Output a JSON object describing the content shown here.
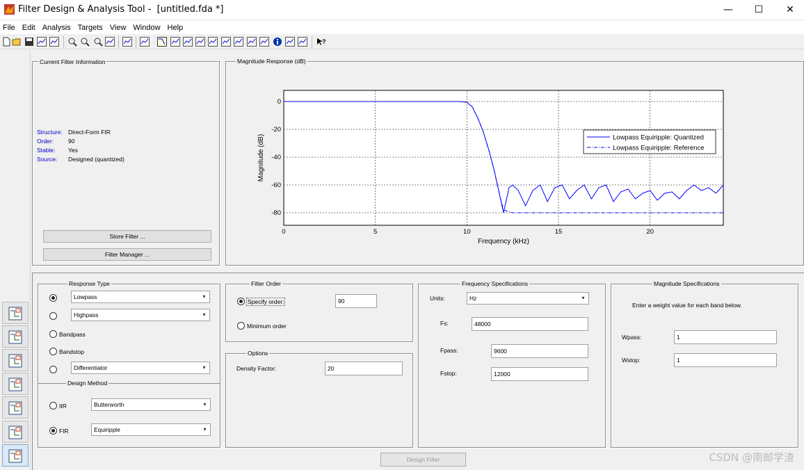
{
  "window": {
    "title": "Filter Design & Analysis Tool -  [untitled.fda *]",
    "minimize_glyph": "—",
    "maximize_glyph": "☐",
    "close_glyph": "✕"
  },
  "menu": [
    "File",
    "Edit",
    "Analysis",
    "Targets",
    "View",
    "Window",
    "Help"
  ],
  "toolbar_icons": [
    "new-icon",
    "open-icon",
    "save-icon",
    "print-icon",
    "print-preview-icon",
    "zoom-in-icon",
    "zoom-x-icon",
    "zoom-y-icon",
    "full-view-icon",
    "new-figure-icon",
    "full-view-analysis-icon",
    "magnitude-response-icon",
    "phase-response-icon",
    "magnitude-phase-icon",
    "group-delay-icon",
    "phase-delay-icon",
    "impulse-response-icon",
    "step-response-icon",
    "pole-zero-icon",
    "coefficients-icon",
    "info-icon",
    "quantization-icon",
    "noise-loading-icon",
    "whats-this-icon"
  ],
  "sidebar_icons": [
    "transform-filter-icon",
    "create-multirate-icon",
    "quantize-icon",
    "realize-model-icon",
    "import-filter-icon",
    "pole-zero-editor-icon",
    "design-filter-icon"
  ],
  "current_filter": {
    "title": "Current Filter Information",
    "rows": [
      {
        "key": "Structure:",
        "value": "Direct-Form FIR"
      },
      {
        "key": "Order:",
        "value": "90"
      },
      {
        "key": "Stable:",
        "value": "Yes"
      },
      {
        "key": "Source:",
        "value": "Designed (quantized)"
      }
    ],
    "store_button": "Store Filter ...",
    "manager_button": "Filter Manager ..."
  },
  "plot": {
    "title": "Magnitude Response (dB)"
  },
  "chart_data": {
    "type": "line",
    "xlabel": "Frequency (kHz)",
    "ylabel": "Magnitude (dB)",
    "xlim": [
      0,
      24
    ],
    "ylim": [
      -70,
      8
    ],
    "xticks": [
      "0",
      "5",
      "10",
      "15",
      "20"
    ],
    "yticks": [
      "0",
      "-20",
      "-40",
      "-60",
      "-80"
    ],
    "grid": true,
    "legend_position": "right",
    "series": [
      {
        "name": "Lowpass Equiripple: Quantized",
        "style": "solid",
        "color": "#0000ff",
        "x": [
          0,
          9.6,
          10,
          10.3,
          10.6,
          10.9,
          11.2,
          11.5,
          11.8,
          12,
          12.3,
          12.5,
          12.8,
          13.2,
          13.6,
          14,
          14.4,
          14.8,
          15.2,
          15.6,
          16,
          16.4,
          16.8,
          17.2,
          17.6,
          18,
          18.4,
          18.8,
          19.2,
          19.6,
          20,
          20.4,
          20.8,
          21.2,
          21.6,
          22,
          22.4,
          22.8,
          23.2,
          23.6,
          24
        ],
        "y": [
          0,
          0,
          -0.5,
          -4,
          -12,
          -22,
          -35,
          -50,
          -68,
          -80,
          -62,
          -60,
          -64,
          -75,
          -64,
          -60,
          -72,
          -62,
          -60,
          -70,
          -64,
          -60,
          -70,
          -62,
          -60,
          -72,
          -65,
          -63,
          -70,
          -66,
          -64,
          -71,
          -66,
          -65,
          -70,
          -64,
          -60,
          -64,
          -62,
          -66,
          -60
        ]
      },
      {
        "name": "Lowpass Equiripple: Reference",
        "style": "dashdot",
        "color": "#0000ff",
        "x": [
          0,
          9.6,
          10,
          10.3,
          10.6,
          10.9,
          11.2,
          11.5,
          11.8,
          12,
          12.5,
          13,
          14,
          15,
          16,
          17,
          18,
          19,
          20,
          21,
          22,
          23,
          24
        ],
        "y": [
          0,
          0,
          -0.5,
          -4,
          -12,
          -22,
          -35,
          -50,
          -68,
          -78,
          -80,
          -80,
          -80,
          -80,
          -80,
          -80,
          -80,
          -80,
          -80,
          -80,
          -80,
          -80,
          -80
        ]
      }
    ]
  },
  "response_type": {
    "title": "Response Type",
    "lowpass": "Lowpass",
    "highpass": "Highpass",
    "bandpass": "Bandpass",
    "bandstop": "Bandstop",
    "differentiator": "Differentiator"
  },
  "design_method": {
    "title": "Design Method",
    "iir_label": "IIR",
    "iir_value": "Butterworth",
    "fir_label": "FIR",
    "fir_value": "Equiripple"
  },
  "filter_order": {
    "title": "Filter Order",
    "specify": "Specify order:",
    "specify_value": "90",
    "minimum": "Minimum order"
  },
  "options": {
    "title": "Options",
    "density_label": "Density Factor:",
    "density_value": "20"
  },
  "freq_specs": {
    "title": "Frequency Specifications",
    "units_label": "Units:",
    "units_value": "Hz",
    "fs_label": "Fs:",
    "fs_value": "48000",
    "fpass_label": "Fpass:",
    "fpass_value": "9600",
    "fstop_label": "Fstop:",
    "fstop_value": "12000"
  },
  "mag_specs": {
    "title": "Magnitude Specifications",
    "hint": "Enter a weight value for each band below.",
    "wpass_label": "Wpass:",
    "wpass_value": "1",
    "wstop_label": "Wstop:",
    "wstop_value": "1"
  },
  "design_button": "Design Filter",
  "watermark": "CSDN @南邮学渣"
}
